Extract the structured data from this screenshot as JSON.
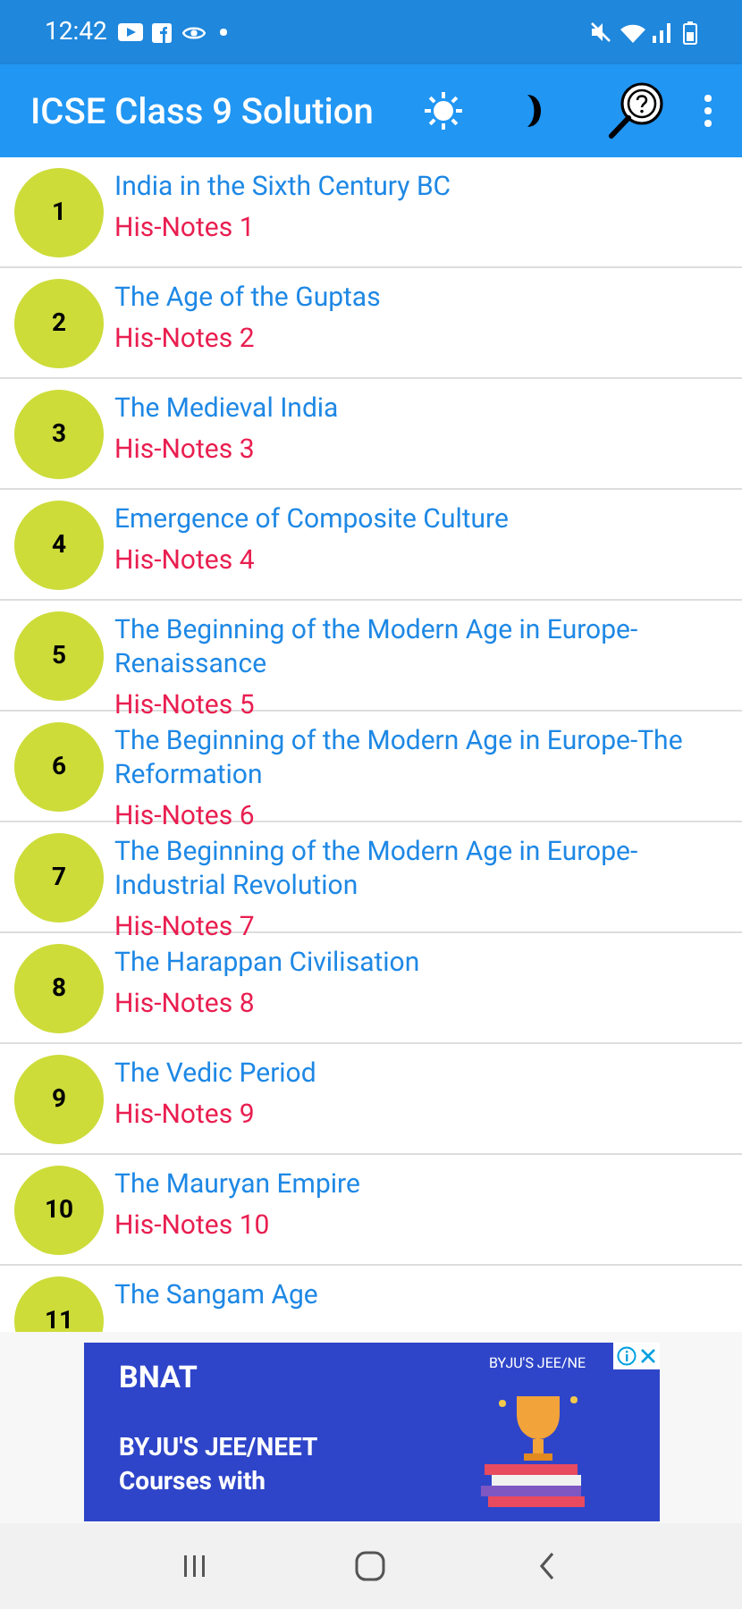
{
  "status_bar": {
    "time": "12:42"
  },
  "app_bar": {
    "title": "ICSE Class 9 Solution"
  },
  "chapters": [
    {
      "number": "1",
      "title": "India in the Sixth Century BC",
      "subtitle": "His-Notes 1"
    },
    {
      "number": "2",
      "title": "The Age of the Guptas",
      "subtitle": "His-Notes 2"
    },
    {
      "number": "3",
      "title": "The Medieval India",
      "subtitle": "His-Notes 3"
    },
    {
      "number": "4",
      "title": "Emergence of Composite Culture",
      "subtitle": "His-Notes 4"
    },
    {
      "number": "5",
      "title": "The Beginning of the Modern Age in Europe-Renaissance",
      "subtitle": "His-Notes 5"
    },
    {
      "number": "6",
      "title": "The Beginning of the Modern Age in Europe-The Reformation",
      "subtitle": "His-Notes 6"
    },
    {
      "number": "7",
      "title": "The Beginning of the Modern Age in Europe-Industrial Revolution",
      "subtitle": "His-Notes 7"
    },
    {
      "number": "8",
      "title": "The Harappan Civilisation",
      "subtitle": "His-Notes 8"
    },
    {
      "number": "9",
      "title": "The Vedic Period",
      "subtitle": "His-Notes 9"
    },
    {
      "number": "10",
      "title": "The Mauryan Empire",
      "subtitle": "His-Notes 10"
    },
    {
      "number": "11",
      "title": "The Sangam Age"
    }
  ],
  "ad": {
    "logo": "BNAT",
    "brand": "BYJU'S JEE/NE",
    "headline": "BYJU'S JEE/NEET",
    "subline": "Courses with"
  }
}
